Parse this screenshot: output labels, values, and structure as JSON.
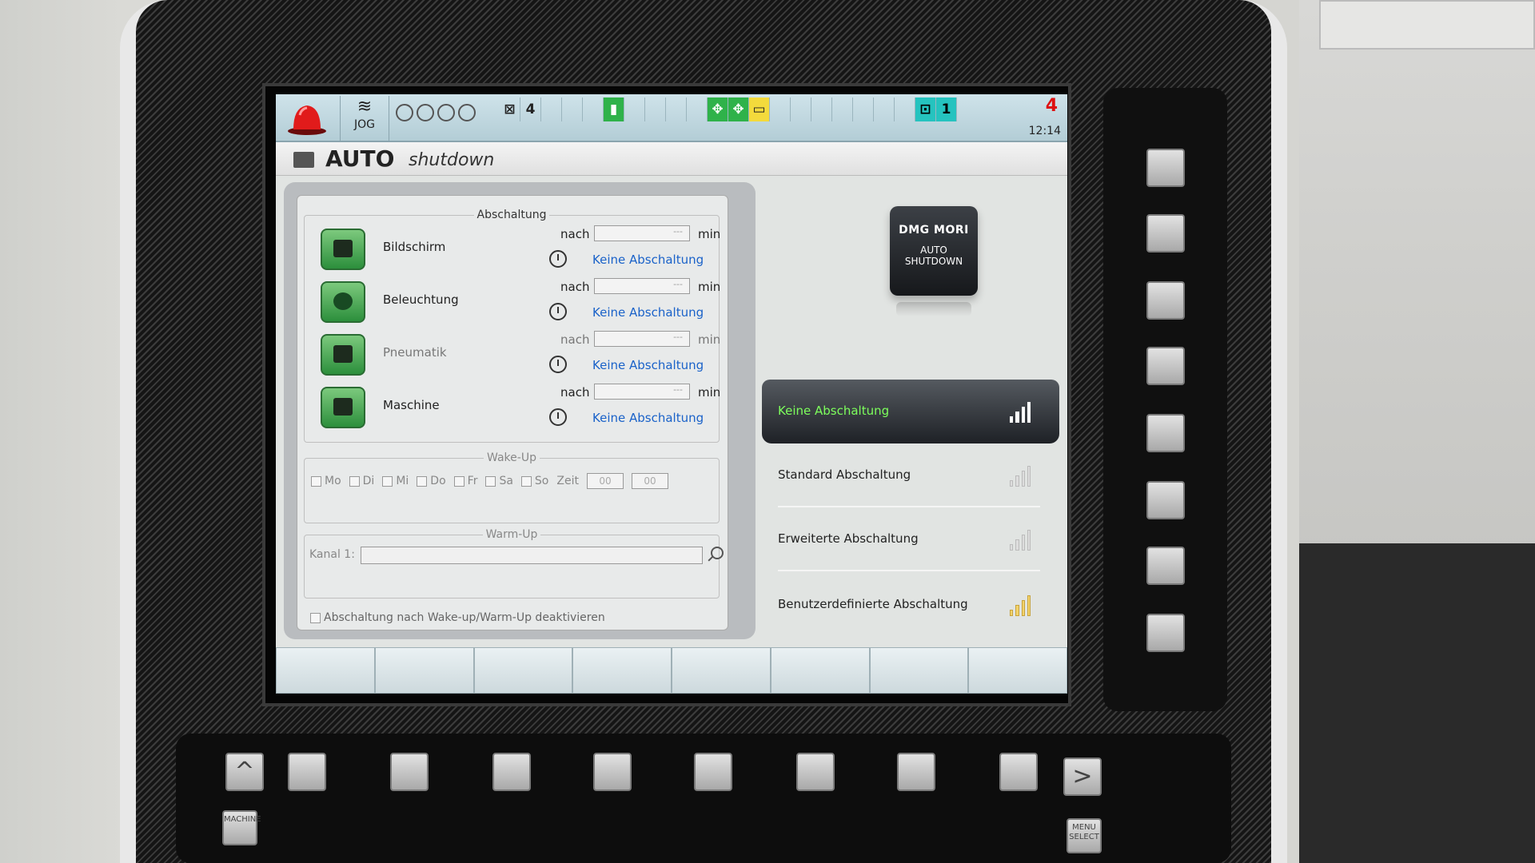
{
  "statusbar": {
    "mode": "JOG",
    "cell_count_a": "4",
    "cell_count_b": "1",
    "alarm_count": "4",
    "time": "12:14",
    "icons": [
      "alarm-beacon-icon",
      "jog-wave-icon",
      "spindle-icon",
      "green-door-icon",
      "workpiece-icon"
    ]
  },
  "title": {
    "bold": "AUTO",
    "italic": "shutdown"
  },
  "abschaltung": {
    "group_title": "Abschaltung",
    "rows": [
      {
        "label": "Bildschirm",
        "nach": "nach",
        "value": "---",
        "unit": "min",
        "link": "Keine Abschaltung",
        "icon": "monitor-icon"
      },
      {
        "label": "Beleuchtung",
        "nach": "nach",
        "value": "---",
        "unit": "min",
        "link": "Keine Abschaltung",
        "icon": "lamp-icon"
      },
      {
        "label": "Pneumatik",
        "nach": "nach",
        "value": "---",
        "unit": "min",
        "link": "Keine Abschaltung",
        "icon": "pneumatic-icon"
      },
      {
        "label": "Maschine",
        "nach": "nach",
        "value": "---",
        "unit": "min",
        "link": "Keine Abschaltung",
        "icon": "machine-icon"
      }
    ]
  },
  "wakeup": {
    "group_title": "Wake-Up",
    "days": [
      "Mo",
      "Di",
      "Mi",
      "Do",
      "Fr",
      "Sa",
      "So"
    ],
    "zeit_label": "Zeit",
    "hour": "00",
    "minute": "00"
  },
  "warmup": {
    "group_title": "Warm-Up",
    "kanal_label": "Kanal 1:"
  },
  "deactivate_label": "Abschaltung nach Wake-up/Warm-Up deaktivieren",
  "logo": {
    "brand": "DMG MORI",
    "line1": "AUTO",
    "line2": "SHUTDOWN"
  },
  "options": [
    {
      "label": "Keine Abschaltung",
      "active": true
    },
    {
      "label": "Standard Abschaltung",
      "active": false
    },
    {
      "label": "Erweiterte Abschaltung",
      "active": false
    },
    {
      "label": "Benutzerdefinierte Abschaltung",
      "active": false
    }
  ],
  "hardware": {
    "machine_key": "MACHINE",
    "menu_key": "MENU SELECT",
    "up_glyph": "^",
    "right_glyph": ">"
  },
  "colors": {
    "active_text": "#7dff5c",
    "link_blue": "#1a62c9",
    "status_green": "#2fb24a",
    "status_teal": "#25c3bf",
    "alarm_red": "#d11111"
  }
}
